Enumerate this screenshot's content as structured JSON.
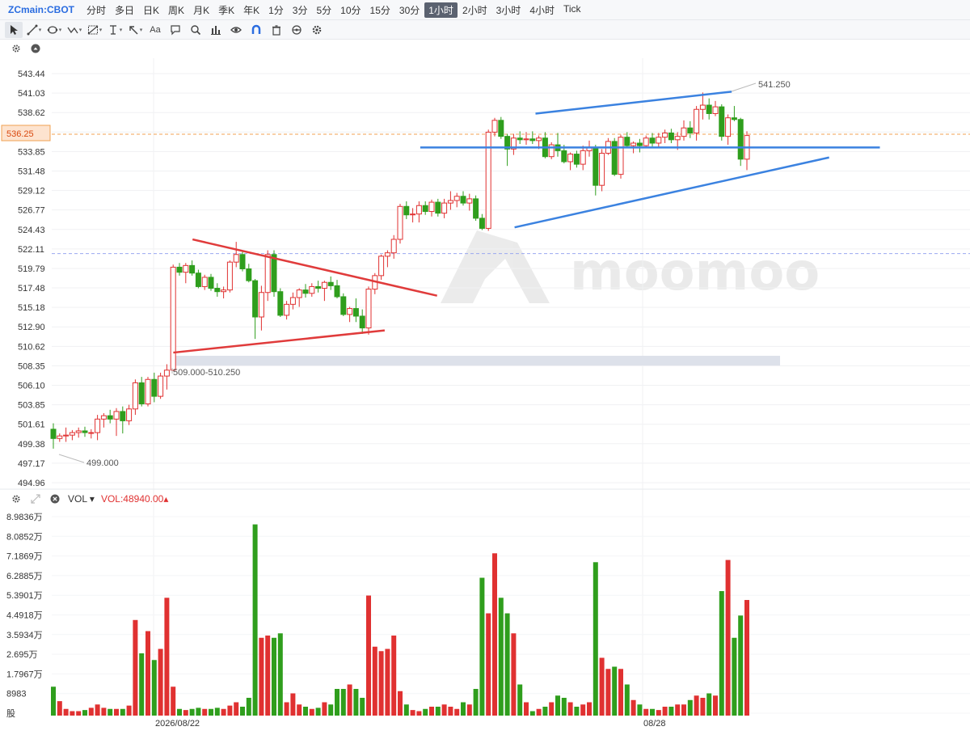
{
  "toolbar": {
    "symbol": "ZCmain:CBOT",
    "timeframes": [
      "分时",
      "多日",
      "日K",
      "周K",
      "月K",
      "季K",
      "年K",
      "1分",
      "3分",
      "5分",
      "10分",
      "15分",
      "30分",
      "1小时",
      "2小时",
      "3小时",
      "4小时",
      "Tick"
    ],
    "active_timeframe": "1小时"
  },
  "tools": [
    "cursor-icon",
    "line-tool-icon",
    "channel-tool-icon",
    "wave-tool-icon",
    "fibonacci-icon",
    "measure-icon",
    "arrow-icon",
    "text-tool-icon",
    "comment-icon",
    "zoom-icon",
    "pattern-icon",
    "eye-icon",
    "magnet-icon",
    "trash-icon",
    "lock-icon",
    "settings-icon"
  ],
  "text_tool_label": "Aa",
  "colors": {
    "up": "#e03131",
    "down": "#2f9e1d",
    "trendline_blue": "#3b82e0",
    "triangle_red": "#e03b3b",
    "price_line": "#f0a050",
    "dashed_blue": "#9aa8f0",
    "accent": "#2b6de0"
  },
  "price_axis": {
    "labels": [
      "543.44",
      "541.03",
      "538.62",
      "536.25",
      "533.85",
      "531.48",
      "529.12",
      "526.77",
      "524.43",
      "522.11",
      "519.79",
      "517.48",
      "515.18",
      "512.90",
      "510.62",
      "508.35",
      "506.10",
      "503.85",
      "501.61",
      "499.38",
      "497.17",
      "494.96"
    ],
    "current_price": "536.25"
  },
  "annotations": {
    "high": "541.250",
    "low": "499.000",
    "range": "509.000-510.250"
  },
  "watermark": "moomoo",
  "volume_panel": {
    "label": "VOL",
    "value_label": "VOL:48940.00",
    "axis_labels": [
      "8.9836万",
      "8.0852万",
      "7.1869万",
      "6.2885万",
      "5.3901万",
      "4.4918万",
      "3.5934万",
      "2.695万",
      "1.7967万",
      "8983",
      "股"
    ]
  },
  "date_labels": [
    "2026/08/22",
    "08/28"
  ],
  "chart_data": {
    "type": "candlestick",
    "y_range": [
      494.96,
      543.44
    ],
    "volume_range": [
      0,
      89836
    ],
    "candles": [
      [
        501.3,
        502.0,
        499.0,
        500.2,
        13000
      ],
      [
        500.2,
        500.8,
        499.8,
        500.5,
        6500
      ],
      [
        500.5,
        501.5,
        499.8,
        500.6,
        3000
      ],
      [
        500.6,
        501.2,
        500.0,
        500.9,
        2000
      ],
      [
        500.9,
        501.5,
        500.3,
        501.1,
        2000
      ],
      [
        501.1,
        501.6,
        500.4,
        500.9,
        2500
      ],
      [
        500.9,
        501.3,
        500.2,
        500.9,
        3500
      ],
      [
        500.9,
        503.0,
        500.0,
        502.5,
        5000
      ],
      [
        502.5,
        503.2,
        501.5,
        502.9,
        3500
      ],
      [
        502.9,
        503.6,
        502.0,
        502.5,
        3000
      ],
      [
        502.5,
        503.8,
        500.5,
        503.4,
        3000
      ],
      [
        503.4,
        504.0,
        500.8,
        502.3,
        3000
      ],
      [
        502.3,
        504.2,
        501.8,
        503.7,
        4500
      ],
      [
        503.7,
        507.2,
        503.0,
        506.8,
        43000
      ],
      [
        506.8,
        507.5,
        504.0,
        504.3,
        28000
      ],
      [
        504.3,
        507.5,
        504.0,
        507.2,
        38000
      ],
      [
        507.2,
        508.0,
        504.5,
        505.2,
        25000
      ],
      [
        505.2,
        508.0,
        504.9,
        507.6,
        30000
      ],
      [
        507.6,
        509.0,
        506.0,
        508.3,
        53000
      ],
      [
        508.3,
        520.8,
        508.2,
        520.5,
        13000
      ],
      [
        520.5,
        521.0,
        519.5,
        519.9,
        3000
      ],
      [
        519.9,
        521.0,
        518.6,
        520.7,
        2500
      ],
      [
        520.7,
        521.3,
        519.5,
        519.8,
        3000
      ],
      [
        519.8,
        520.2,
        518.0,
        518.2,
        3500
      ],
      [
        518.2,
        519.6,
        517.8,
        519.3,
        3000
      ],
      [
        519.3,
        519.7,
        517.7,
        518.0,
        3000
      ],
      [
        518.0,
        518.6,
        517.0,
        517.6,
        3500
      ],
      [
        517.6,
        518.2,
        516.8,
        517.8,
        3000
      ],
      [
        517.8,
        521.3,
        517.5,
        521.1,
        4500
      ],
      [
        521.1,
        523.5,
        520.5,
        522.0,
        6000
      ],
      [
        522.0,
        522.5,
        520.0,
        520.3,
        4000
      ],
      [
        520.3,
        520.9,
        518.7,
        518.9,
        8000
      ],
      [
        518.9,
        519.1,
        512.0,
        514.6,
        86000
      ],
      [
        514.6,
        518.3,
        513.0,
        517.5,
        35000
      ],
      [
        517.5,
        522.5,
        516.5,
        522.0,
        36000
      ],
      [
        522.0,
        522.5,
        517.0,
        517.6,
        35000
      ],
      [
        517.6,
        518.0,
        514.6,
        514.8,
        37000
      ],
      [
        514.8,
        516.5,
        514.3,
        516.1,
        6000
      ],
      [
        516.1,
        517.5,
        515.5,
        516.9,
        10000
      ],
      [
        516.9,
        518.0,
        515.8,
        517.8,
        5000
      ],
      [
        517.8,
        518.5,
        516.9,
        517.4,
        4000
      ],
      [
        517.4,
        518.6,
        517.0,
        518.2,
        3000
      ],
      [
        518.2,
        518.9,
        517.5,
        518.0,
        3500
      ],
      [
        518.0,
        518.9,
        516.5,
        518.7,
        6000
      ],
      [
        518.7,
        519.4,
        517.8,
        518.3,
        5000
      ],
      [
        518.3,
        519.0,
        516.8,
        517.0,
        12000
      ],
      [
        517.0,
        517.4,
        514.7,
        514.9,
        12000
      ],
      [
        514.9,
        515.8,
        514.0,
        515.6,
        14000
      ],
      [
        515.6,
        516.8,
        514.0,
        514.7,
        12000
      ],
      [
        514.7,
        515.5,
        512.6,
        513.3,
        8000
      ],
      [
        513.3,
        518.2,
        512.5,
        517.9,
        54000
      ],
      [
        517.9,
        519.8,
        517.3,
        519.5,
        31000
      ],
      [
        519.5,
        522.0,
        519.0,
        521.8,
        29000
      ],
      [
        521.8,
        522.5,
        520.5,
        522.2,
        30000
      ],
      [
        522.2,
        524.3,
        521.5,
        523.8,
        36000
      ],
      [
        523.8,
        528.0,
        523.3,
        527.7,
        11000
      ],
      [
        527.7,
        528.3,
        526.2,
        526.7,
        5000
      ],
      [
        526.7,
        527.5,
        525.8,
        526.8,
        2500
      ],
      [
        526.8,
        528.3,
        525.8,
        527.8,
        2000
      ],
      [
        527.8,
        528.3,
        526.7,
        527.1,
        3000
      ],
      [
        527.1,
        528.5,
        526.5,
        528.2,
        4000
      ],
      [
        528.2,
        528.6,
        526.5,
        526.9,
        4000
      ],
      [
        526.9,
        528.6,
        526.3,
        528.1,
        5000
      ],
      [
        528.1,
        529.5,
        527.3,
        528.4,
        4000
      ],
      [
        528.4,
        529.3,
        527.6,
        528.9,
        3000
      ],
      [
        528.9,
        529.5,
        527.8,
        528.1,
        6000
      ],
      [
        528.1,
        529.2,
        527.2,
        528.6,
        5000
      ],
      [
        528.6,
        529.0,
        526.0,
        526.3,
        12000
      ],
      [
        526.3,
        526.8,
        524.9,
        525.1,
        62000
      ],
      [
        525.1,
        536.8,
        524.8,
        536.5,
        46000
      ],
      [
        536.5,
        538.2,
        536.0,
        537.9,
        73000
      ],
      [
        537.9,
        538.3,
        535.7,
        536.0,
        53000
      ],
      [
        536.0,
        536.3,
        532.5,
        534.5,
        46000
      ],
      [
        534.5,
        536.3,
        533.8,
        535.8,
        37000
      ],
      [
        535.8,
        536.6,
        535.1,
        535.6,
        14000
      ],
      [
        535.6,
        536.5,
        535.0,
        535.7,
        6000
      ],
      [
        535.7,
        536.6,
        535.1,
        535.5,
        2000
      ],
      [
        535.5,
        536.1,
        534.5,
        535.8,
        3000
      ],
      [
        535.8,
        536.5,
        533.4,
        533.6,
        4000
      ],
      [
        533.6,
        535.3,
        533.3,
        535.0,
        6000
      ],
      [
        535.0,
        536.4,
        533.6,
        534.3,
        9000
      ],
      [
        534.3,
        535.0,
        532.8,
        533.0,
        8000
      ],
      [
        533.0,
        534.1,
        532.0,
        533.9,
        6000
      ],
      [
        533.9,
        534.3,
        532.3,
        532.7,
        4000
      ],
      [
        532.7,
        534.9,
        532.0,
        534.3,
        5000
      ],
      [
        534.3,
        535.5,
        533.6,
        534.7,
        6000
      ],
      [
        534.7,
        535.0,
        529.0,
        530.2,
        69000
      ],
      [
        530.2,
        534.5,
        529.5,
        534.0,
        26000
      ],
      [
        534.0,
        535.8,
        533.8,
        535.4,
        21000
      ],
      [
        535.4,
        535.8,
        531.3,
        531.5,
        22000
      ],
      [
        531.5,
        536.2,
        531.0,
        535.9,
        21000
      ],
      [
        535.9,
        536.5,
        534.6,
        534.9,
        14000
      ],
      [
        534.9,
        535.4,
        534.0,
        535.2,
        7000
      ],
      [
        535.2,
        535.7,
        534.1,
        534.9,
        5000
      ],
      [
        534.9,
        536.1,
        534.6,
        535.8,
        3000
      ],
      [
        535.8,
        536.4,
        534.8,
        535.2,
        3000
      ],
      [
        535.2,
        536.4,
        534.6,
        535.9,
        2500
      ],
      [
        535.9,
        536.8,
        535.2,
        536.4,
        4000
      ],
      [
        536.4,
        536.9,
        535.2,
        535.6,
        4000
      ],
      [
        535.6,
        536.5,
        534.4,
        536.0,
        5000
      ],
      [
        536.0,
        537.9,
        535.5,
        537.0,
        5000
      ],
      [
        537.0,
        537.8,
        535.8,
        536.4,
        7000
      ],
      [
        536.4,
        539.6,
        535.5,
        539.2,
        9000
      ],
      [
        539.2,
        541.2,
        538.0,
        539.7,
        8000
      ],
      [
        539.7,
        540.5,
        538.0,
        538.7,
        10000
      ],
      [
        538.7,
        540.2,
        538.4,
        539.5,
        9000
      ],
      [
        539.5,
        539.8,
        535.5,
        536.0,
        56000
      ],
      [
        536.0,
        538.6,
        535.0,
        538.2,
        70000
      ],
      [
        538.2,
        539.6,
        537.8,
        538.0,
        35000
      ],
      [
        538.0,
        538.2,
        532.5,
        533.3,
        45000
      ],
      [
        533.3,
        536.6,
        532.0,
        536.1,
        52000
      ]
    ],
    "lines": {
      "blue_resistance": [
        [
          0.6625,
          538.7
        ],
        [
          0.9051,
          541.3
        ]
      ],
      "blue_horizontal": [
        [
          0.5199,
          534.68
        ],
        [
          1.0885,
          534.68
        ]
      ],
      "blue_support": [
        [
          0.6366,
          525.22
        ],
        [
          1.0257,
          533.5
        ]
      ],
      "red_upper": [
        [
          0.2382,
          523.79
        ],
        [
          0.5407,
          517.12
        ]
      ],
      "red_lower": [
        [
          0.2144,
          510.38
        ],
        [
          0.4759,
          513.01
        ]
      ]
    }
  }
}
